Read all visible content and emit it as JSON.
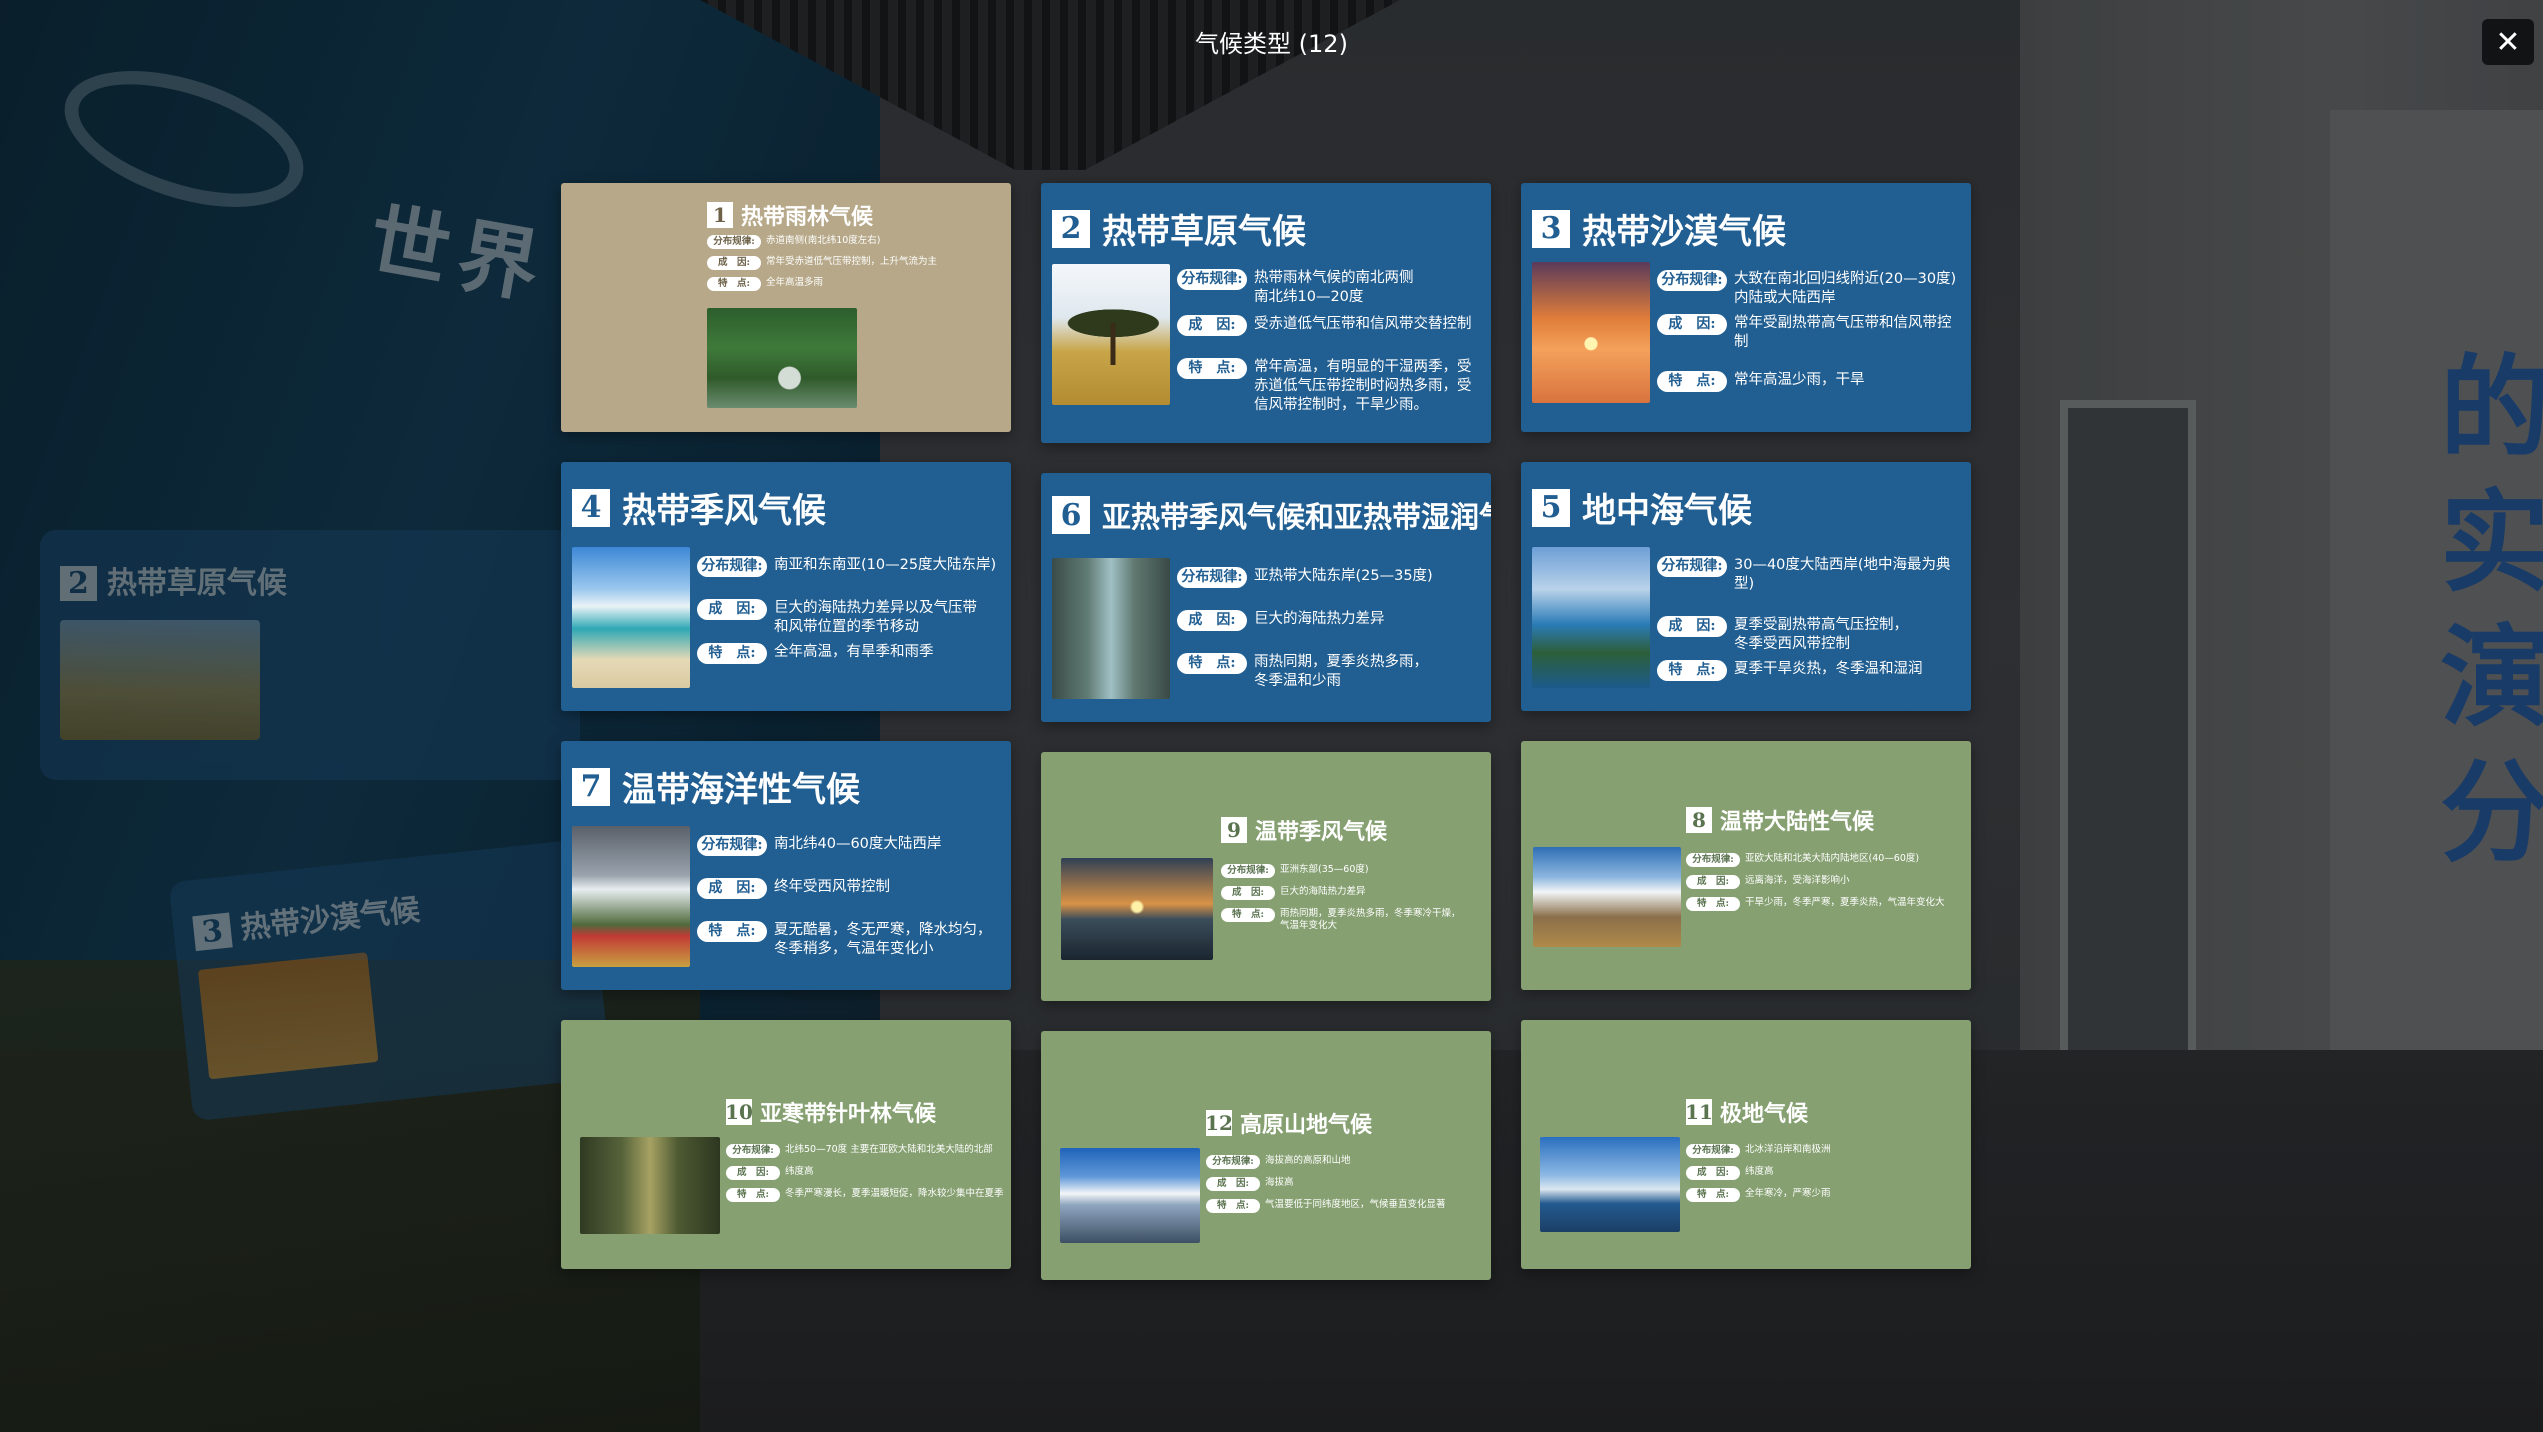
{
  "window": {
    "title": "气候类型 (12)",
    "close_label": "✕"
  },
  "background": {
    "wall_text": "世界",
    "side_text": "的\n实\n演\n分",
    "panel_a": {
      "num": "2",
      "title": "热带草原气候"
    },
    "panel_b": {
      "num": "3",
      "title": "热带沙漠气候"
    }
  },
  "labels": {
    "dist": "分布规律:",
    "cause": "成　因:",
    "feature": "特　点:"
  },
  "cards": [
    {
      "num": "1",
      "title": "热带雨林气候",
      "image": "rainforest-photo",
      "dist": "赤道南侧(南北纬10度左右)",
      "cause": "常年受赤道低气压带控制，上升气流为主",
      "feature": "全年高温多雨"
    },
    {
      "num": "2",
      "title": "热带草原气候",
      "image": "savanna-photo",
      "dist": "热带雨林气候的南北两侧\n南北纬10—20度",
      "cause": "受赤道低气压带和信风带交替控制",
      "feature": "常年高温，有明显的干湿两季，受赤道低气压带控制时闷热多雨，受信风带控制时，干旱少雨。"
    },
    {
      "num": "3",
      "title": "热带沙漠气候",
      "image": "desert-photo",
      "dist": "大致在南北回归线附近(20—30度)\n内陆或大陆西岸",
      "cause": "常年受副热带高气压带和信风带控制",
      "feature": "常年高温少雨，干旱"
    },
    {
      "num": "4",
      "title": "热带季风气候",
      "image": "beach-photo",
      "dist": "南亚和东南亚(10—25度大陆东岸)",
      "cause": "巨大的海陆热力差异以及气压带\n和风带位置的季节移动",
      "feature": "全年高温，有旱季和雨季"
    },
    {
      "num": "6",
      "title": "亚热带季风气候和亚热带湿润气候",
      "image": "gorge-photo",
      "dist": "亚热带大陆东岸(25—35度)",
      "cause": "巨大的海陆热力差异",
      "feature": "雨热同期，夏季炎热多雨，\n冬季温和少雨"
    },
    {
      "num": "5",
      "title": "地中海气候",
      "image": "coast-photo",
      "dist": "30—40度大陆西岸(地中海最为典型)",
      "cause": "夏季受副热带高气压控制，\n冬季受西风带控制",
      "feature": "夏季干旱炎热，冬季温和湿润"
    },
    {
      "num": "7",
      "title": "温带海洋性气候",
      "image": "mountain-house-photo",
      "dist": "南北纬40—60度大陆西岸",
      "cause": "终年受西风带控制",
      "feature": "夏无酷暑，冬无严寒，降水均匀，\n冬季稍多，气温年变化小"
    },
    {
      "num": "9",
      "title": "温带季风气候",
      "image": "lake-sunset-photo",
      "dist": "亚洲东部(35—60度)",
      "cause": "巨大的海陆热力差异",
      "feature": "雨热同期，夏季炎热多雨，冬季寒冷干燥，\n气温年变化大"
    },
    {
      "num": "8",
      "title": "温带大陆性气候",
      "image": "patagonia-photo",
      "dist": "亚欧大陆和北美大陆内陆地区(40—60度)",
      "cause": "远离海洋，受海洋影响小",
      "feature": "干旱少雨，冬季严寒，夏季炎热，气温年变化大"
    },
    {
      "num": "10",
      "title": "亚寒带针叶林气候",
      "image": "taiga-photo",
      "dist": "北纬50—70度 主要在亚欧大陆和北美大陆的北部",
      "cause": "纬度高",
      "feature": "冬季严寒漫长，夏季温暖短促，降水较少集中在夏季"
    },
    {
      "num": "12",
      "title": "高原山地气候",
      "image": "plateau-photo",
      "dist": "海拔高的高原和山地",
      "cause": "海拔高",
      "feature": "气温要低于同纬度地区，气候垂直变化显著"
    },
    {
      "num": "11",
      "title": "极地气候",
      "image": "polar-photo",
      "dist": "北冰洋沿岸和南极洲",
      "cause": "纬度高",
      "feature": "全年寒冷，严寒少雨"
    }
  ]
}
